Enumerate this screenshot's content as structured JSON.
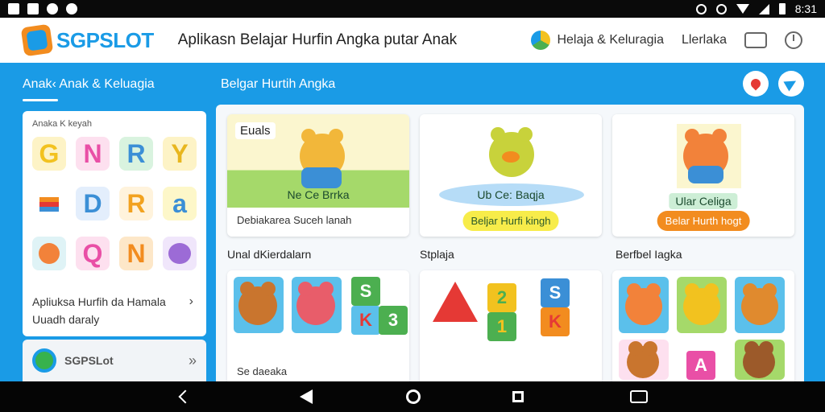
{
  "status_bar": {
    "time": "8:31"
  },
  "header": {
    "logo_text": "SGPSLOT",
    "app_title": "Aplikasn Belajar Hurfin Angka putar Anak",
    "category_link": "Helaja & Keluragia",
    "nav_link": "Llerlaka"
  },
  "tabs": {
    "left_tab": "Anak‹  Anak & Keluagia",
    "main_tab": "Belgar Hurtih Angka"
  },
  "left_panel": {
    "heading": "Anaka K keyah",
    "letters": [
      "G",
      "N",
      "R",
      "Y",
      "",
      "D",
      "R",
      "a",
      "",
      "Q",
      "N",
      ""
    ],
    "description": "Apliuksa Hurfih da Hamala Uuadh daraly",
    "promo_label": "SGPSLot"
  },
  "cards": {
    "card1": {
      "badge": "Euals",
      "caption": "Ne Ce Brrka",
      "desc": "Debiakarea Suceh lanah"
    },
    "card2": {
      "caption": "Ub Ce: Baqja",
      "button": "Beljar Hurfi kingh"
    },
    "card3": {
      "caption": "Ular Celiga",
      "button": "Belar Hurth hogt"
    }
  },
  "sections": {
    "s1_title": "Unal dKierdalarn",
    "s2_title": "Stplaja",
    "s3_title": "Berfbel Iagka",
    "s1_label": "Se daeaka"
  },
  "colors": {
    "brand_blue": "#1a9be6",
    "accent_orange": "#f28c1f",
    "accent_yellow": "#f2e02a"
  }
}
